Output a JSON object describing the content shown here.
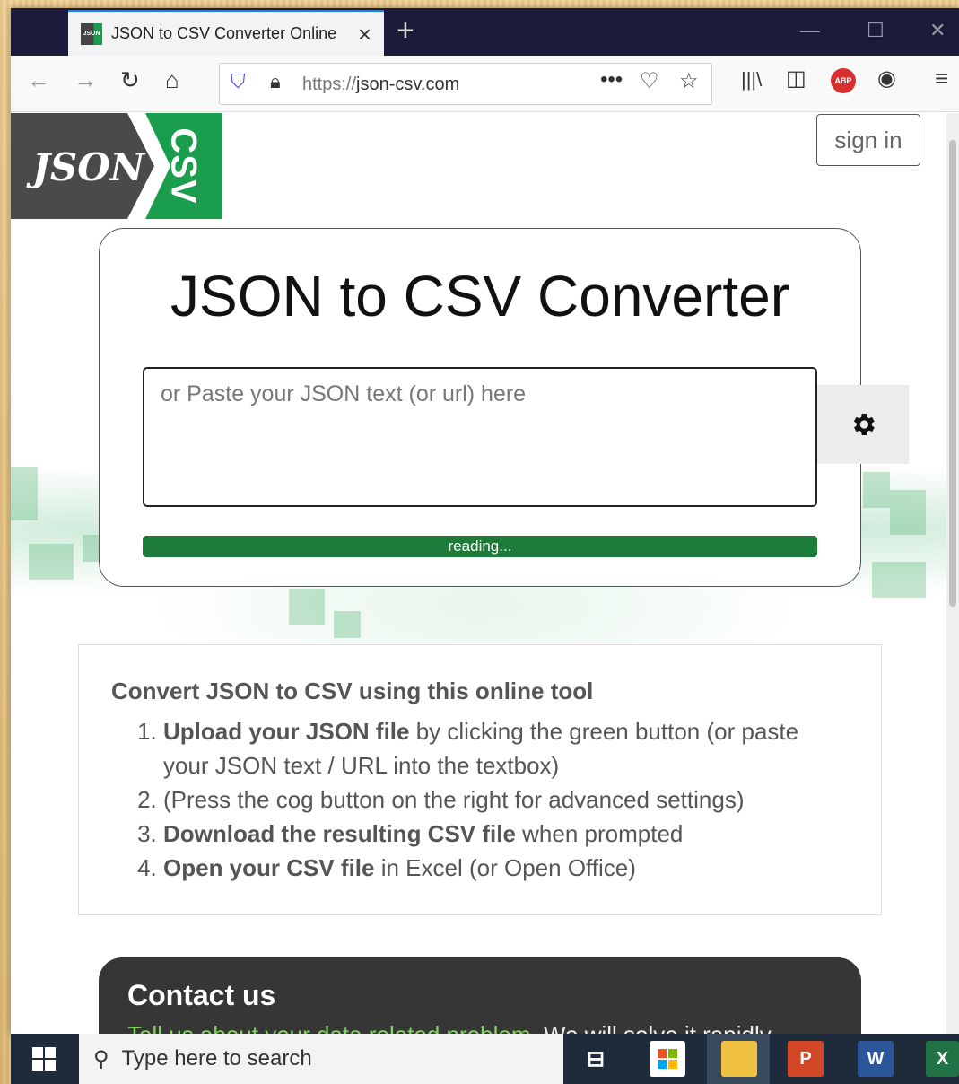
{
  "browser": {
    "tab_title": "JSON to CSV Converter Online",
    "url_prefix": "https://",
    "url_host": "json-csv.com"
  },
  "page": {
    "logo_left": "JSON",
    "logo_right": "CSV",
    "signin_label": "sign in",
    "title": "JSON to CSV Converter",
    "input_placeholder": "or Paste your JSON text (or url) here",
    "progress_label": "reading...",
    "info": {
      "heading": "Convert JSON to CSV using this online tool",
      "steps": [
        {
          "bold": "Upload your JSON file",
          "rest": " by clicking the green button (or paste your JSON text / URL into the textbox)"
        },
        {
          "bold": "",
          "rest": "(Press the cog button on the right for advanced settings)"
        },
        {
          "bold": "Download the resulting CSV file",
          "rest": " when prompted"
        },
        {
          "bold": "Open your CSV file",
          "rest": " in Excel (or Open Office)"
        }
      ]
    },
    "contact": {
      "heading": "Contact us",
      "link_text": "Tell us about your data related problem.",
      "rest": " We will solve it rapidly."
    }
  },
  "taskbar": {
    "search_placeholder": "Type here to search"
  },
  "colors": {
    "brand_green": "#1a9d4c",
    "progress_green": "#1e7c3a",
    "logo_gray": "#4a4a4a"
  }
}
